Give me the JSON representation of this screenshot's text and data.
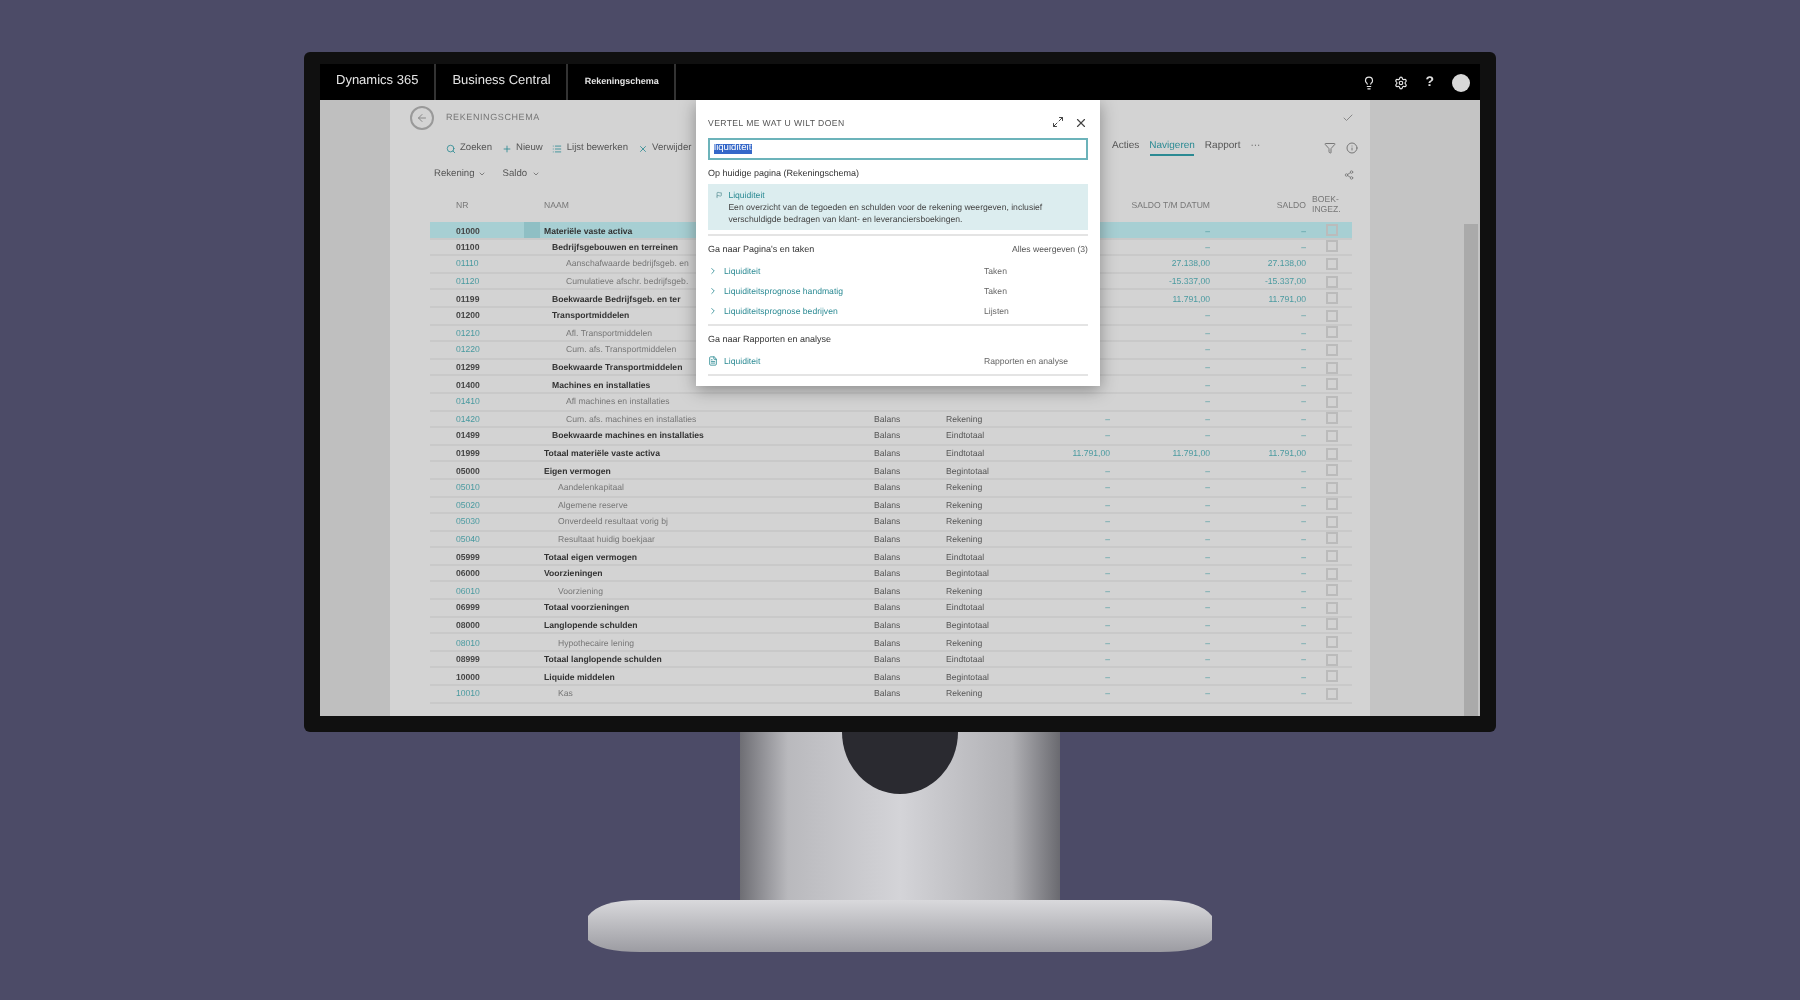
{
  "top_bar": {
    "app": "Dynamics 365",
    "product": "Business Central",
    "page": "Rekeningschema",
    "help": "?"
  },
  "page": {
    "title": "REKENINGSCHEMA",
    "actions": [
      "Zoeken",
      "Nieuw",
      "Lijst bewerken",
      "Verwijder"
    ],
    "menus": [
      {
        "label": "Acties",
        "selected": false
      },
      {
        "label": "Navigeren",
        "selected": true
      },
      {
        "label": "Rapport",
        "selected": false
      }
    ],
    "more": "···",
    "filters": [
      "Rekening",
      "Saldo"
    ]
  },
  "table": {
    "header": {
      "nr": "NR",
      "naam": "NAAM",
      "saldo_tm_datum": "SALDO T/M DATUM",
      "saldo": "SALDO",
      "boek_ingez": "BOEK- INGEZ."
    },
    "rows": [
      {
        "nr": "01000",
        "name": "Materiële vaste activa",
        "kind": "heading",
        "selected": true,
        "saldo_tm_datum": "–",
        "saldo": "–",
        "children": [
          {
            "nr": "01100",
            "name": "Bedrijfsgebouwen en terreinen",
            "kind": "heading",
            "selected": false,
            "saldo_tm_datum": "–",
            "saldo": "–",
            "children": [
              {
                "nr": "01110",
                "name": "Aanschafwaarde bedrijfsgeb. en",
                "kind": "account",
                "selected": false,
                "saldo_tm_datum": "27.138,00",
                "saldo": "27.138,00"
              },
              {
                "nr": "01120",
                "name": "Cumulatieve afschr. bedrijfsgeb.",
                "kind": "account",
                "selected": false,
                "saldo_tm_datum": "-15.337,00",
                "saldo": "-15.337,00"
              }
            ]
          },
          {
            "nr": "01199",
            "name": "Boekwaarde Bedrijfsgeb. en ter",
            "kind": "heading",
            "selected": false,
            "saldo_tm_datum": "11.791,00",
            "saldo": "11.791,00"
          },
          {
            "nr": "01200",
            "name": "Transportmiddelen",
            "kind": "heading",
            "selected": false,
            "saldo_tm_datum": "–",
            "saldo": "–",
            "children": [
              {
                "nr": "01210",
                "name": "Afl. Transportmiddelen",
                "kind": "account",
                "selected": false,
                "saldo_tm_datum": "–",
                "saldo": "–"
              },
              {
                "nr": "01220",
                "name": "Cum. afs. Transportmiddelen",
                "kind": "account",
                "selected": false,
                "saldo_tm_datum": "–",
                "saldo": "–"
              }
            ]
          },
          {
            "nr": "01299",
            "name": "Boekwaarde Transportmiddelen",
            "kind": "heading",
            "selected": false,
            "saldo_tm_datum": "–",
            "saldo": "–"
          },
          {
            "nr": "01400",
            "name": "Machines en installaties",
            "kind": "heading",
            "selected": false,
            "saldo_tm_datum": "–",
            "saldo": "–",
            "children": [
              {
                "nr": "01410",
                "name": "Afl machines en installaties",
                "kind": "account",
                "selected": false,
                "saldo_tm_datum": "–",
                "saldo": "–"
              },
              {
                "nr": "01420",
                "name": "Cum. afs. machines en installaties",
                "kind": "account",
                "selected": false,
                "column_3": "Balans",
                "column_4": "Rekening",
                "column_5": "–",
                "saldo_tm_datum": "–",
                "saldo": "–"
              }
            ]
          },
          {
            "nr": "01499",
            "name": "Boekwaarde machines en installaties",
            "kind": "heading",
            "selected": false,
            "column_3": "Balans",
            "column_4": "Eindtotaal",
            "column_5": "–",
            "saldo_tm_datum": "–",
            "saldo": "–"
          }
        ]
      },
      {
        "nr": "01999",
        "name": "Totaal materiële vaste activa",
        "kind": "heading",
        "selected": false,
        "column_3": "Balans",
        "column_4": "Eindtotaal",
        "column_5": "11.791,00",
        "saldo_tm_datum": "11.791,00",
        "saldo": "11.791,00"
      },
      {
        "nr": "05000",
        "name": "Eigen vermogen",
        "kind": "heading",
        "selected": false,
        "column_3": "Balans",
        "column_4": "Begintotaal",
        "column_5": "–",
        "saldo_tm_datum": "–",
        "saldo": "–",
        "children": [
          {
            "nr": "05010",
            "name": "Aandelenkapitaal",
            "kind": "account",
            "selected": false,
            "column_3": "Balans",
            "column_4": "Rekening",
            "column_5": "–",
            "saldo_tm_datum": "–",
            "saldo": "–"
          },
          {
            "nr": "05020",
            "name": "Algemene reserve",
            "kind": "account",
            "selected": false,
            "column_3": "Balans",
            "column_4": "Rekening",
            "column_5": "–",
            "saldo_tm_datum": "–",
            "saldo": "–"
          },
          {
            "nr": "05030",
            "name": "Onverdeeld resultaat vorig bj",
            "kind": "account",
            "selected": false,
            "column_3": "Balans",
            "column_4": "Rekening",
            "column_5": "–",
            "saldo_tm_datum": "–",
            "saldo": "–"
          },
          {
            "nr": "05040",
            "name": "Resultaat huidig boekjaar",
            "kind": "account",
            "selected": false,
            "column_3": "Balans",
            "column_4": "Rekening",
            "column_5": "–",
            "saldo_tm_datum": "–",
            "saldo": "–"
          }
        ]
      },
      {
        "nr": "05999",
        "name": "Totaal eigen vermogen",
        "kind": "heading",
        "selected": false,
        "column_3": "Balans",
        "column_4": "Eindtotaal",
        "column_5": "–",
        "saldo_tm_datum": "–",
        "saldo": "–"
      },
      {
        "nr": "06000",
        "name": "Voorzieningen",
        "kind": "heading",
        "selected": false,
        "column_3": "Balans",
        "column_4": "Begintotaal",
        "column_5": "–",
        "saldo_tm_datum": "–",
        "saldo": "–",
        "children": [
          {
            "nr": "06010",
            "name": "Voorziening",
            "kind": "account",
            "selected": false,
            "column_3": "Balans",
            "column_4": "Rekening",
            "column_5": "–",
            "saldo_tm_datum": "–",
            "saldo": "–"
          }
        ]
      },
      {
        "nr": "06999",
        "name": "Totaal voorzieningen",
        "kind": "heading",
        "selected": false,
        "column_3": "Balans",
        "column_4": "Eindtotaal",
        "column_5": "–",
        "saldo_tm_datum": "–",
        "saldo": "–"
      },
      {
        "nr": "08000",
        "name": "Langlopende schulden",
        "kind": "heading",
        "selected": false,
        "column_3": "Balans",
        "column_4": "Begintotaal",
        "column_5": "–",
        "saldo_tm_datum": "–",
        "saldo": "–",
        "children": [
          {
            "nr": "08010",
            "name": "Hypothecaire lening",
            "kind": "account",
            "selected": false,
            "column_3": "Balans",
            "column_4": "Rekening",
            "column_5": "–",
            "saldo_tm_datum": "–",
            "saldo": "–"
          }
        ]
      },
      {
        "nr": "08999",
        "name": "Totaal langlopende schulden",
        "kind": "heading",
        "selected": false,
        "column_3": "Balans",
        "column_4": "Eindtotaal",
        "column_5": "–",
        "saldo_tm_datum": "–",
        "saldo": "–"
      },
      {
        "nr": "10000",
        "name": "Liquide middelen",
        "kind": "heading",
        "selected": false,
        "column_3": "Balans",
        "column_4": "Begintotaal",
        "column_5": "–",
        "saldo_tm_datum": "–",
        "saldo": "–",
        "children": [
          {
            "nr": "10010",
            "name": "Kas",
            "kind": "account",
            "selected": false,
            "column_3": "Balans",
            "column_4": "Rekening",
            "column_5": "–",
            "saldo_tm_datum": "–",
            "saldo": "–"
          }
        ]
      }
    ]
  },
  "dialog": {
    "title": "VERTEL ME WAT U WILT DOEN",
    "search_value": "liquiditeit",
    "current_page": {
      "heading": "Op huidige pagina (Rekeningschema)",
      "item": {
        "label": "Liquiditeit",
        "description": "Een overzicht van de tegoeden en schulden voor de rekening weergeven, inclusief verschuldigde bedragen van klant- en leveranciersboekingen."
      }
    },
    "pages": {
      "heading": "Ga naar Pagina's en taken",
      "show_all": "Alles weergeven (3)",
      "items": [
        {
          "label": "Liquiditeit",
          "category": "Taken"
        },
        {
          "label": "Liquiditeitsprognose handmatig",
          "category": "Taken"
        },
        {
          "label": "Liquiditeitsprognose bedrijven",
          "category": "Lijsten"
        }
      ]
    },
    "reports": {
      "heading": "Ga naar Rapporten en analyse",
      "items": [
        {
          "label": "Liquiditeit",
          "category": "Rapporten en analyse"
        }
      ]
    }
  }
}
